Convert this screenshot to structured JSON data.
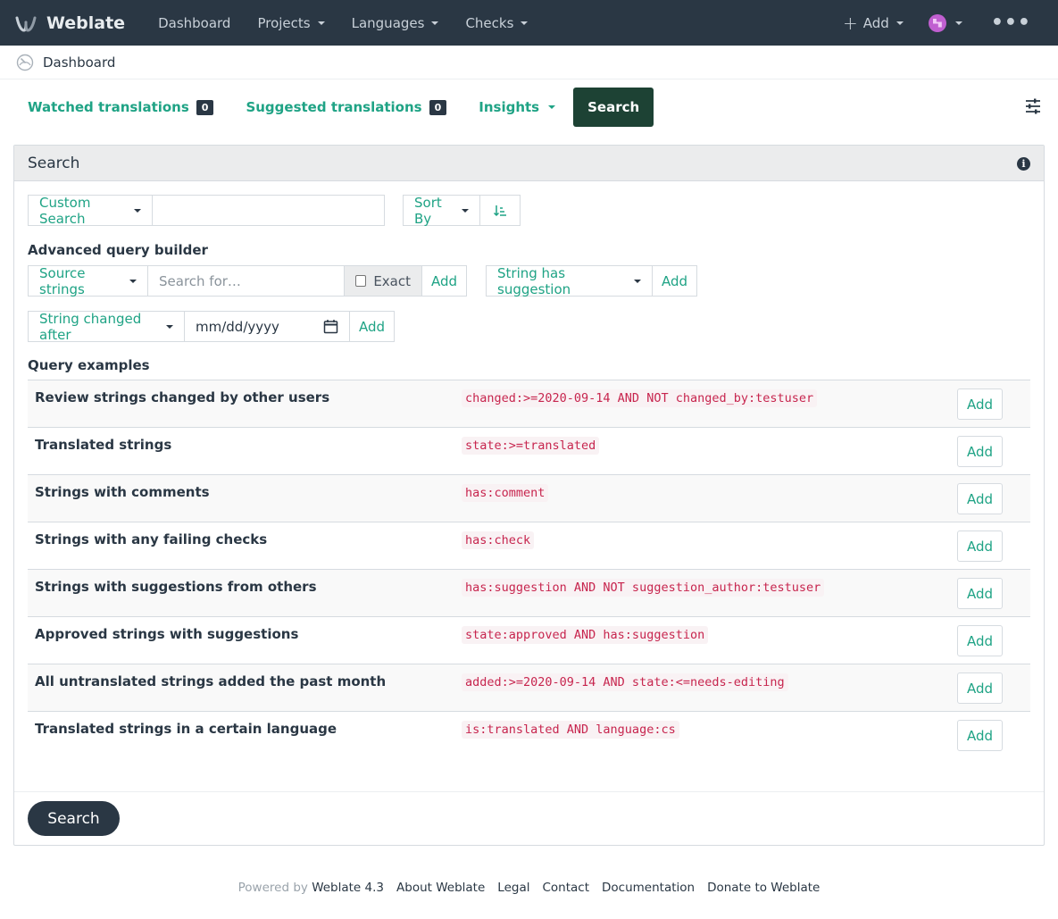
{
  "navbar": {
    "brand": "Weblate",
    "items": [
      {
        "label": "Dashboard",
        "dropdown": false
      },
      {
        "label": "Projects",
        "dropdown": true
      },
      {
        "label": "Languages",
        "dropdown": true
      },
      {
        "label": "Checks",
        "dropdown": true
      }
    ],
    "add_label": "Add"
  },
  "breadcrumb": {
    "label": "Dashboard"
  },
  "tabs": {
    "watched": {
      "label": "Watched translations",
      "count": "0"
    },
    "suggested": {
      "label": "Suggested translations",
      "count": "0"
    },
    "insights": {
      "label": "Insights"
    },
    "search": {
      "label": "Search"
    }
  },
  "panel": {
    "title": "Search",
    "custom_search": "Custom Search",
    "sort_by": "Sort By",
    "advanced_label": "Advanced query builder",
    "source_strings": "Source strings",
    "search_placeholder": "Search for…",
    "exact_label": "Exact",
    "add_label": "Add",
    "string_has_suggestion": "String has suggestion",
    "string_changed_after": "String changed after",
    "date_placeholder": "mm/dd/yyyy",
    "query_examples_label": "Query examples",
    "examples": [
      {
        "name": "Review strings changed by other users",
        "query": "changed:>=2020-09-14 AND NOT changed_by:testuser",
        "add": "Add"
      },
      {
        "name": "Translated strings",
        "query": "state:>=translated",
        "add": "Add"
      },
      {
        "name": "Strings with comments",
        "query": "has:comment",
        "add": "Add"
      },
      {
        "name": "Strings with any failing checks",
        "query": "has:check",
        "add": "Add"
      },
      {
        "name": "Strings with suggestions from others",
        "query": "has:suggestion AND NOT suggestion_author:testuser",
        "add": "Add"
      },
      {
        "name": "Approved strings with suggestions",
        "query": "state:approved AND has:suggestion",
        "add": "Add"
      },
      {
        "name": "All untranslated strings added the past month",
        "query": "added:>=2020-09-14 AND state:<=needs-editing",
        "add": "Add"
      },
      {
        "name": "Translated strings in a certain language",
        "query": "is:translated AND language:cs",
        "add": "Add"
      }
    ],
    "submit_label": "Search"
  },
  "footer": {
    "powered_by": "Powered by",
    "version": "Weblate 4.3",
    "links": [
      "About Weblate",
      "Legal",
      "Contact",
      "Documentation",
      "Donate to Weblate"
    ]
  },
  "colors": {
    "navbar_bg": "#2a3744",
    "accent": "#1fa385",
    "active_tab": "#1d4234",
    "code": "#c7254e"
  }
}
